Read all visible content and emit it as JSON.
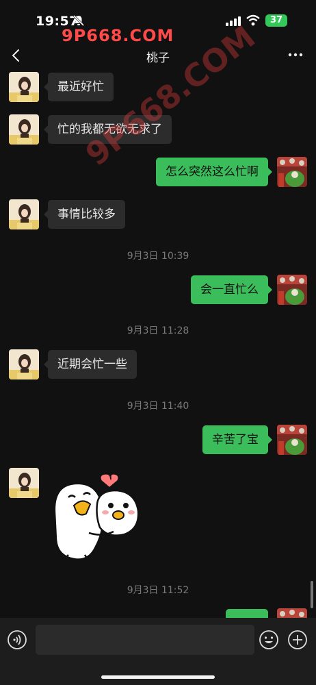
{
  "status_bar": {
    "time": "19:57",
    "battery": "37"
  },
  "watermark": {
    "top_text": "9P668.COM",
    "diagonal_text": "9P668.COM"
  },
  "nav": {
    "title": "桃子"
  },
  "messages": [
    {
      "side": "left",
      "text": "最近好忙"
    },
    {
      "side": "left",
      "text": "忙的我都无欲无求了"
    },
    {
      "side": "right",
      "text": "怎么突然这么忙啊"
    },
    {
      "side": "left",
      "text": "事情比较多"
    },
    {
      "side": "time",
      "text": "9月3日 10:39"
    },
    {
      "side": "right",
      "text": "会一直忙么"
    },
    {
      "side": "time",
      "text": "9月3日 11:28"
    },
    {
      "side": "left",
      "text": "近期会忙一些"
    },
    {
      "side": "time",
      "text": "9月3日 11:40"
    },
    {
      "side": "right",
      "text": "辛苦了宝"
    },
    {
      "side": "left",
      "text": "",
      "sticker": "hugging-ducks-sticker"
    },
    {
      "side": "time",
      "text": "9月3日 11:52"
    },
    {
      "side": "right",
      "text": ""
    }
  ],
  "input_bar": {
    "placeholder": ""
  },
  "colors": {
    "outgoing_bubble": "#3bbd5b",
    "incoming_bubble": "#2c2c2c",
    "background": "#111111"
  }
}
